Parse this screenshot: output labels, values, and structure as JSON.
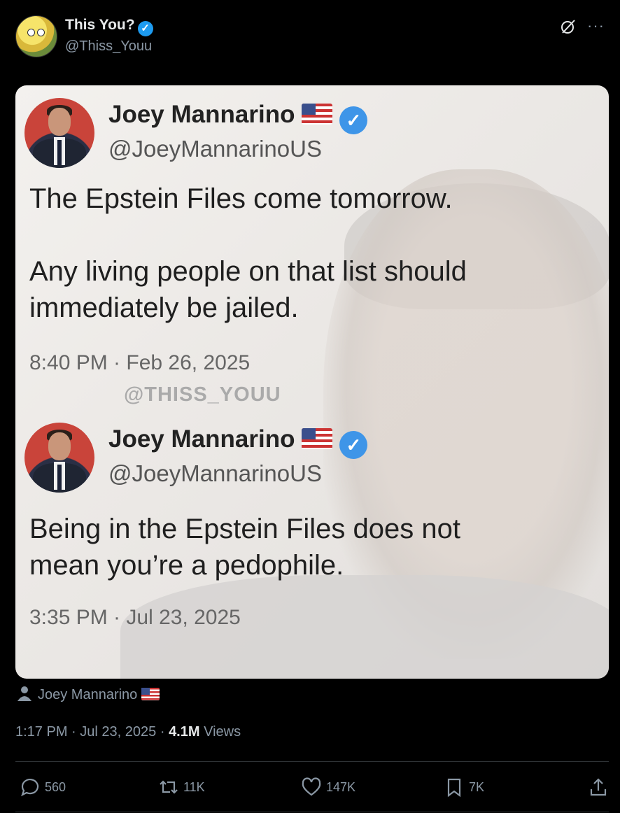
{
  "post": {
    "author_name": "This You?",
    "author_handle": "@Thiss_Youu",
    "media_credit": "Joey Mannarino",
    "time": "1:17 PM",
    "date": "Jul 23, 2025",
    "views_count": "4.1M",
    "views_label": "Views",
    "separator": "·"
  },
  "image": {
    "watermark": "@THISS_YOUU",
    "tweets": [
      {
        "name": "Joey Mannarino",
        "handle": "@JoeyMannarinoUS",
        "text_line1": "The Epstein Files come tomorrow.",
        "text_line2": "Any living people on that list should",
        "text_line3": "immediately be jailed.",
        "timestamp": "8:40 PM · Feb 26, 2025"
      },
      {
        "name": "Joey Mannarino",
        "handle": "@JoeyMannarinoUS",
        "text_line1": "Being in the Epstein Files does not",
        "text_line2": "mean you’re a pedophile.",
        "timestamp": "3:35 PM · Jul 23, 2025"
      }
    ]
  },
  "actions": {
    "replies": "560",
    "reposts": "11K",
    "likes": "147K",
    "bookmarks": "7K"
  },
  "icons": {
    "verified": "verified-badge-icon",
    "grok": "grok-icon",
    "more": "more-icon",
    "reply": "reply-icon",
    "repost": "repost-icon",
    "like": "heart-icon",
    "bookmark": "bookmark-icon",
    "share": "share-icon",
    "person": "person-icon",
    "flag": "us-flag-icon"
  },
  "colors": {
    "background": "#000000",
    "verified": "#1d9bf0",
    "muted": "#8b98a5"
  }
}
